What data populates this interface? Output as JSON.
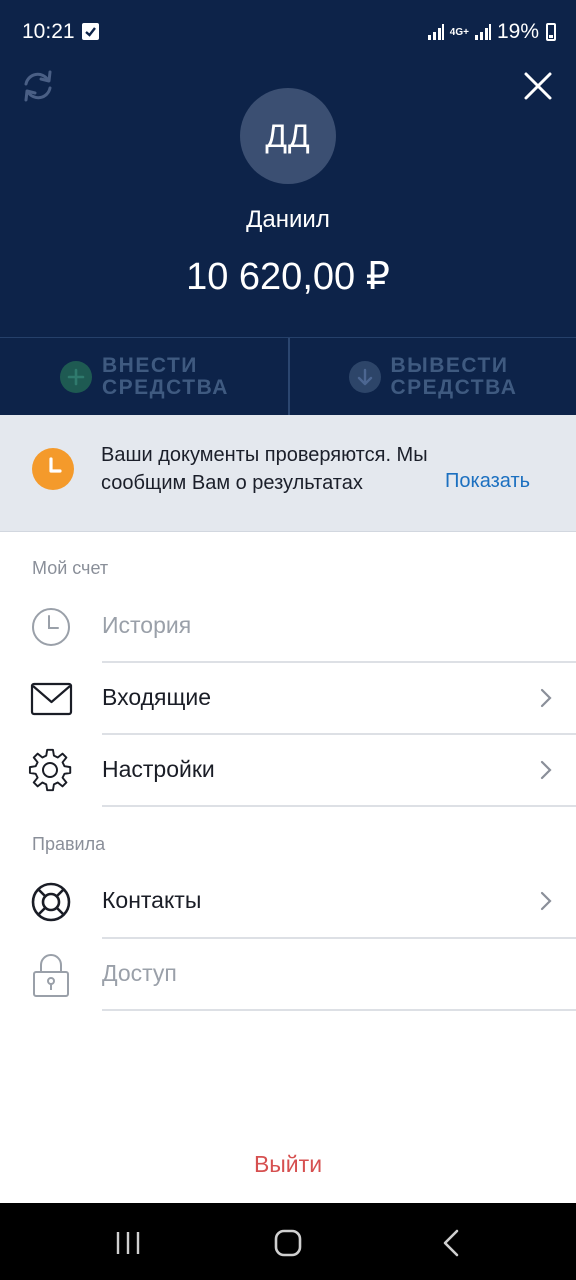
{
  "status_bar": {
    "time": "10:21",
    "network": "4G+",
    "battery": "19%"
  },
  "header": {
    "avatar_initials": "ДД",
    "user_name": "Даниил",
    "balance": "10 620,00 ₽"
  },
  "actions": {
    "deposit_label": "ВНЕСТИ СРЕДСТВА",
    "withdraw_label": "ВЫВЕСТИ СРЕДСТВА"
  },
  "notice": {
    "text": "Ваши документы проверяются. Мы сообщим Вам о результатах проверки",
    "link": "Показать"
  },
  "sections": {
    "account_title": "Мой счет",
    "rules_title": "Правила"
  },
  "menu": {
    "history": "История",
    "inbox": "Входящие",
    "settings": "Настройки",
    "contacts": "Контакты",
    "access": "Доступ"
  },
  "logout_label": "Выйти",
  "colors": {
    "header_bg": "#0d2349",
    "accent_link": "#1c70c0",
    "warning": "#f49a2b",
    "logout": "#d65050"
  }
}
